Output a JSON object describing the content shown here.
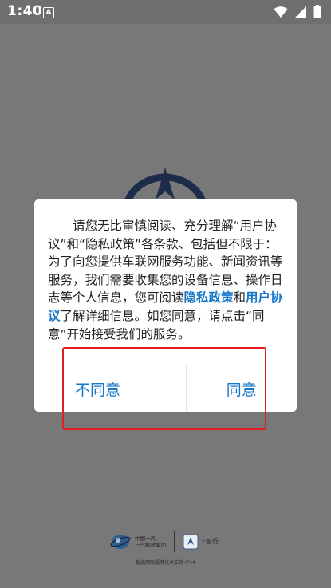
{
  "status_bar": {
    "time": "1:40",
    "notification_letter": "A"
  },
  "dialog": {
    "para_part1": "请您无比审慎阅读、充分理解“用户协议”和“隐私政策”各条款、包括但不限于：为了向您提供车联网服务功能、新闻资讯等服务，我们需要收集您的设备信息、操作日志等个人信息，您可阅读",
    "privacy_link": "隐私政策",
    "para_part2": "和",
    "user_agreement_link": "用户协议",
    "para_part3": "了解详细信息。如您同意，请点击“同意”开始接受我们的服务。",
    "disagree_label": "不同意",
    "agree_label": "同意"
  },
  "footer": {
    "company_line1": "中国一汽",
    "company_line2": "一汽解放集团",
    "brand_right": "E智行",
    "note": "智能网联服务技术支持 IPv4"
  },
  "colors": {
    "link": "#1677c9",
    "annotation": "#e02020",
    "overlay": "#787878"
  }
}
